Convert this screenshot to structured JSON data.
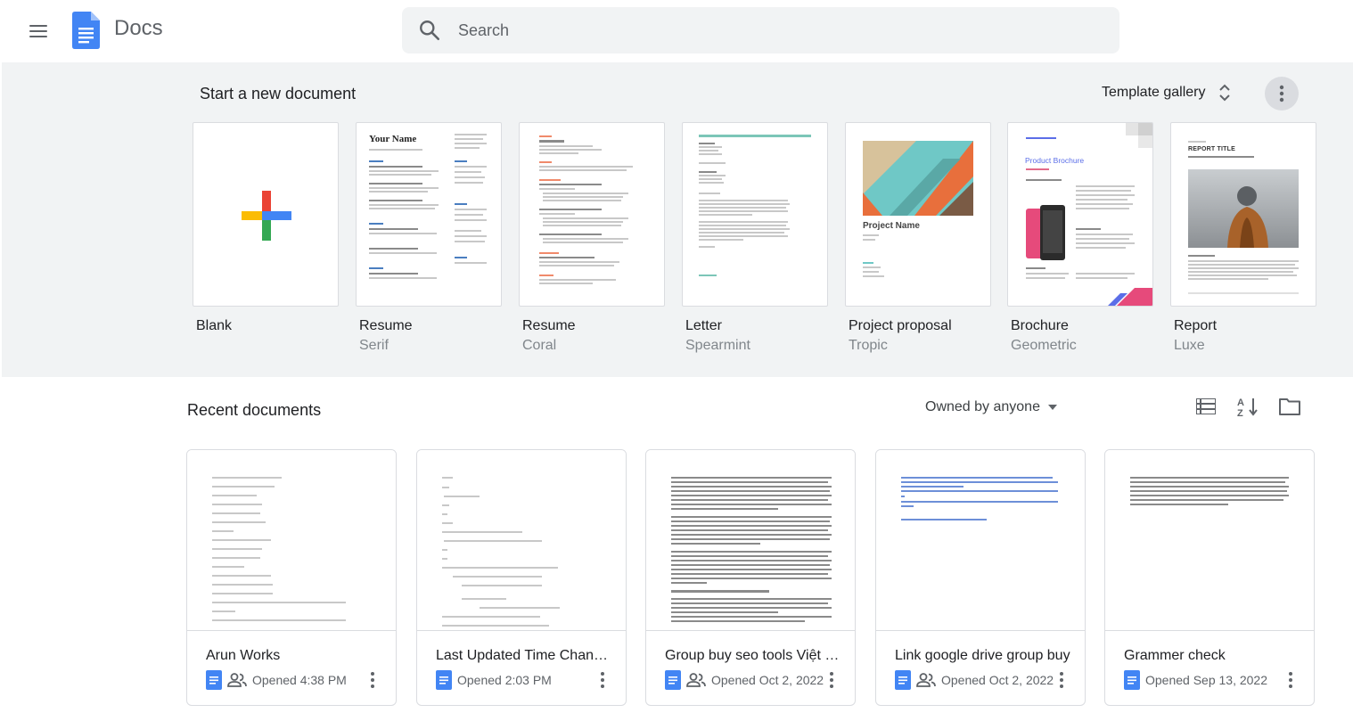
{
  "app": {
    "title": "Docs"
  },
  "search": {
    "placeholder": "Search"
  },
  "templates": {
    "heading": "Start a new document",
    "gallery_label": "Template gallery",
    "items": [
      {
        "name": "Blank",
        "sub": ""
      },
      {
        "name": "Resume",
        "sub": "Serif",
        "preview_title": "Your Name"
      },
      {
        "name": "Resume",
        "sub": "Coral"
      },
      {
        "name": "Letter",
        "sub": "Spearmint"
      },
      {
        "name": "Project proposal",
        "sub": "Tropic",
        "preview_title": "Project Name"
      },
      {
        "name": "Brochure",
        "sub": "Geometric",
        "preview_title": "Product Brochure"
      },
      {
        "name": "Report",
        "sub": "Luxe",
        "preview_title": "REPORT TITLE"
      }
    ]
  },
  "recent": {
    "heading": "Recent documents",
    "owner_filter": "Owned by anyone",
    "docs": [
      {
        "title": "Arun Works",
        "opened": "Opened 4:38 PM",
        "shared": true
      },
      {
        "title": "Last Updated Time Changer",
        "opened": "Opened 2:03 PM",
        "shared": false
      },
      {
        "title": "Group buy seo tools Việt Nam",
        "opened": "Opened Oct 2, 2022",
        "shared": true
      },
      {
        "title": "Link google drive group buy",
        "opened": "Opened Oct 2, 2022",
        "shared": true
      },
      {
        "title": "Grammer check",
        "opened": "Opened Sep 13, 2022",
        "shared": false
      }
    ]
  },
  "colors": {
    "docs_blue": "#4285f4",
    "google_red": "#ea4335",
    "google_yellow": "#fbbc04",
    "google_green": "#34a853"
  }
}
